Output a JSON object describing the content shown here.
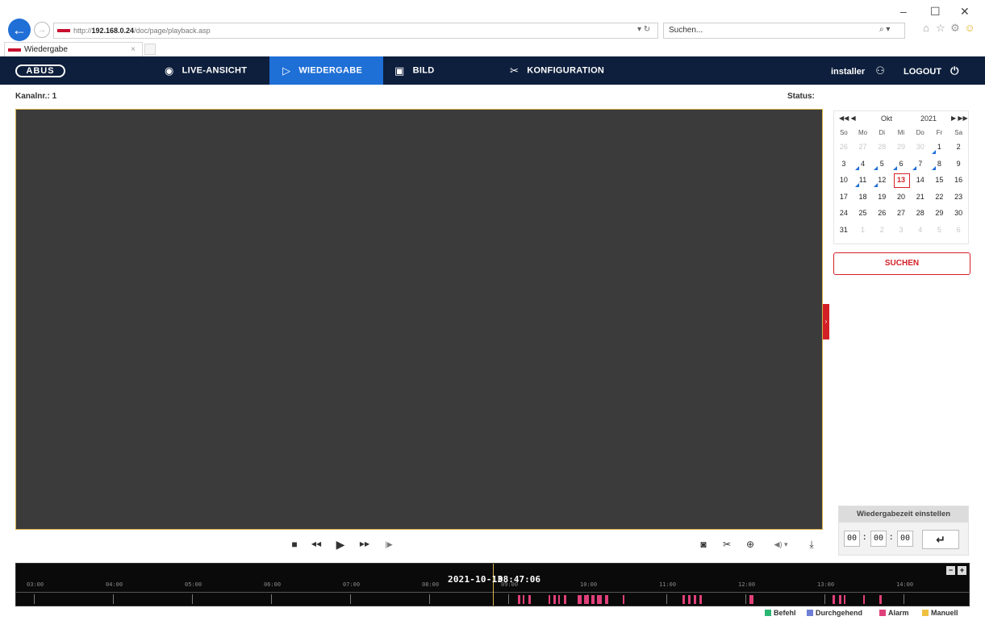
{
  "browser": {
    "url_prefix": "http://",
    "url_host": "192.168.0.24",
    "url_path": "/doc/page/playback.asp",
    "addr_controls": "▾ ↻",
    "search_placeholder": "Suchen...",
    "search_icon": "⌕ ▾",
    "tab_title": "Wiedergabe",
    "tab_close": "×",
    "win_min": "–",
    "win_max": "☐",
    "win_close": "✕"
  },
  "header": {
    "logo": "ABUS",
    "menu": [
      {
        "label": "LIVE-ANSICHT",
        "icon": "camera-eye-icon"
      },
      {
        "label": "WIEDERGABE",
        "icon": "play-icon"
      },
      {
        "label": "BILD",
        "icon": "image-icon"
      },
      {
        "label": "KONFIGURATION",
        "icon": "tools-icon"
      }
    ],
    "user": "installer",
    "logout": "LOGOUT"
  },
  "info": {
    "channel": "Kanalnr.: 1",
    "status": "Status:"
  },
  "calendar": {
    "nav_prev": "◀◀ ◀",
    "nav_next": "▶ ▶▶",
    "month": "Okt",
    "year": "2021",
    "weekdays": [
      "So",
      "Mo",
      "Di",
      "Mi",
      "Do",
      "Fr",
      "Sa"
    ],
    "weeks": [
      [
        "26",
        "27",
        "28",
        "29",
        "30",
        "1",
        "2"
      ],
      [
        "3",
        "4",
        "5",
        "6",
        "7",
        "8",
        "9"
      ],
      [
        "10",
        "11",
        "12",
        "13",
        "14",
        "15",
        "16"
      ],
      [
        "17",
        "18",
        "19",
        "20",
        "21",
        "22",
        "23"
      ],
      [
        "24",
        "25",
        "26",
        "27",
        "28",
        "29",
        "30"
      ],
      [
        "31",
        "1",
        "2",
        "3",
        "4",
        "5",
        "6"
      ]
    ],
    "selected_day": "13"
  },
  "search_button": "SUCHEN",
  "playback_time": {
    "title": "Wiedergabezeit einstellen",
    "hh": "00",
    "mm": "00",
    "ss": "00",
    "enter_icon": "↵"
  },
  "controls": {
    "stop": "■",
    "rewind": "◀◀",
    "play": "▶",
    "fast_forward": "▶▶",
    "frame_step": "|▶",
    "snapshot": "◙",
    "clip": "✂",
    "zoom": "⊕",
    "volume": "◀) ▾",
    "download": "⤓"
  },
  "timeline": {
    "date": "2021-10-13",
    "time": "08:47:06",
    "hours": [
      "03:00",
      "04:00",
      "05:00",
      "06:00",
      "07:00",
      "08:00",
      "09:00",
      "10:00",
      "11:00",
      "12:00",
      "13:00",
      "14:00"
    ],
    "zoom_out": "−",
    "zoom_in": "+"
  },
  "legend": [
    {
      "label": "Befehl",
      "color": "#2bb673"
    },
    {
      "label": "Durchgehend",
      "color": "#6f7fd6"
    },
    {
      "label": "Alarm",
      "color": "#e0407a"
    },
    {
      "label": "Manuell",
      "color": "#f0c040"
    }
  ]
}
